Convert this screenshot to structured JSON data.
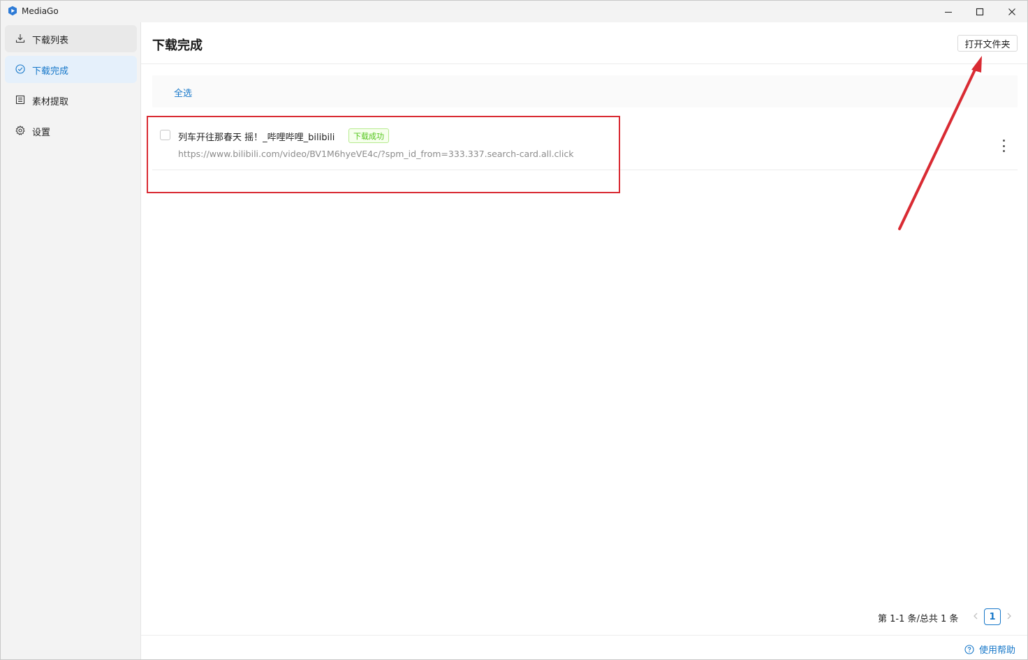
{
  "window": {
    "title": "MediaGo",
    "icon": "mediago-logo-icon",
    "controls": [
      "minimize-icon",
      "maximize-icon",
      "close-icon"
    ]
  },
  "sidebar": {
    "items": [
      {
        "label": "下载列表",
        "icon": "download-icon",
        "state": "hover"
      },
      {
        "label": "下载完成",
        "icon": "check-circle-icon",
        "state": "active"
      },
      {
        "label": "素材提取",
        "icon": "document-icon",
        "state": "normal"
      },
      {
        "label": "设置",
        "icon": "gear-icon",
        "state": "normal"
      }
    ]
  },
  "main": {
    "page_title": "下载完成",
    "open_folder_label": "打开文件夹",
    "select_all_label": "全选",
    "list": [
      {
        "title": "列车开往那春天 摇！_哔哩哔哩_bilibili",
        "status": "下载成功",
        "url": "https://www.bilibili.com/video/BV1M6hyeVE4c/?spm_id_from=333.337.search-card.all.click",
        "checked": false
      }
    ],
    "pagination": {
      "summary": "第 1-1 条/总共 1 条",
      "current_page": "1"
    },
    "help_label": "使用帮助"
  },
  "colors": {
    "accent": "#1677c9",
    "success": "#52c41a",
    "annotation": "#d92b33",
    "sidebar_bg": "#f3f3f3"
  }
}
